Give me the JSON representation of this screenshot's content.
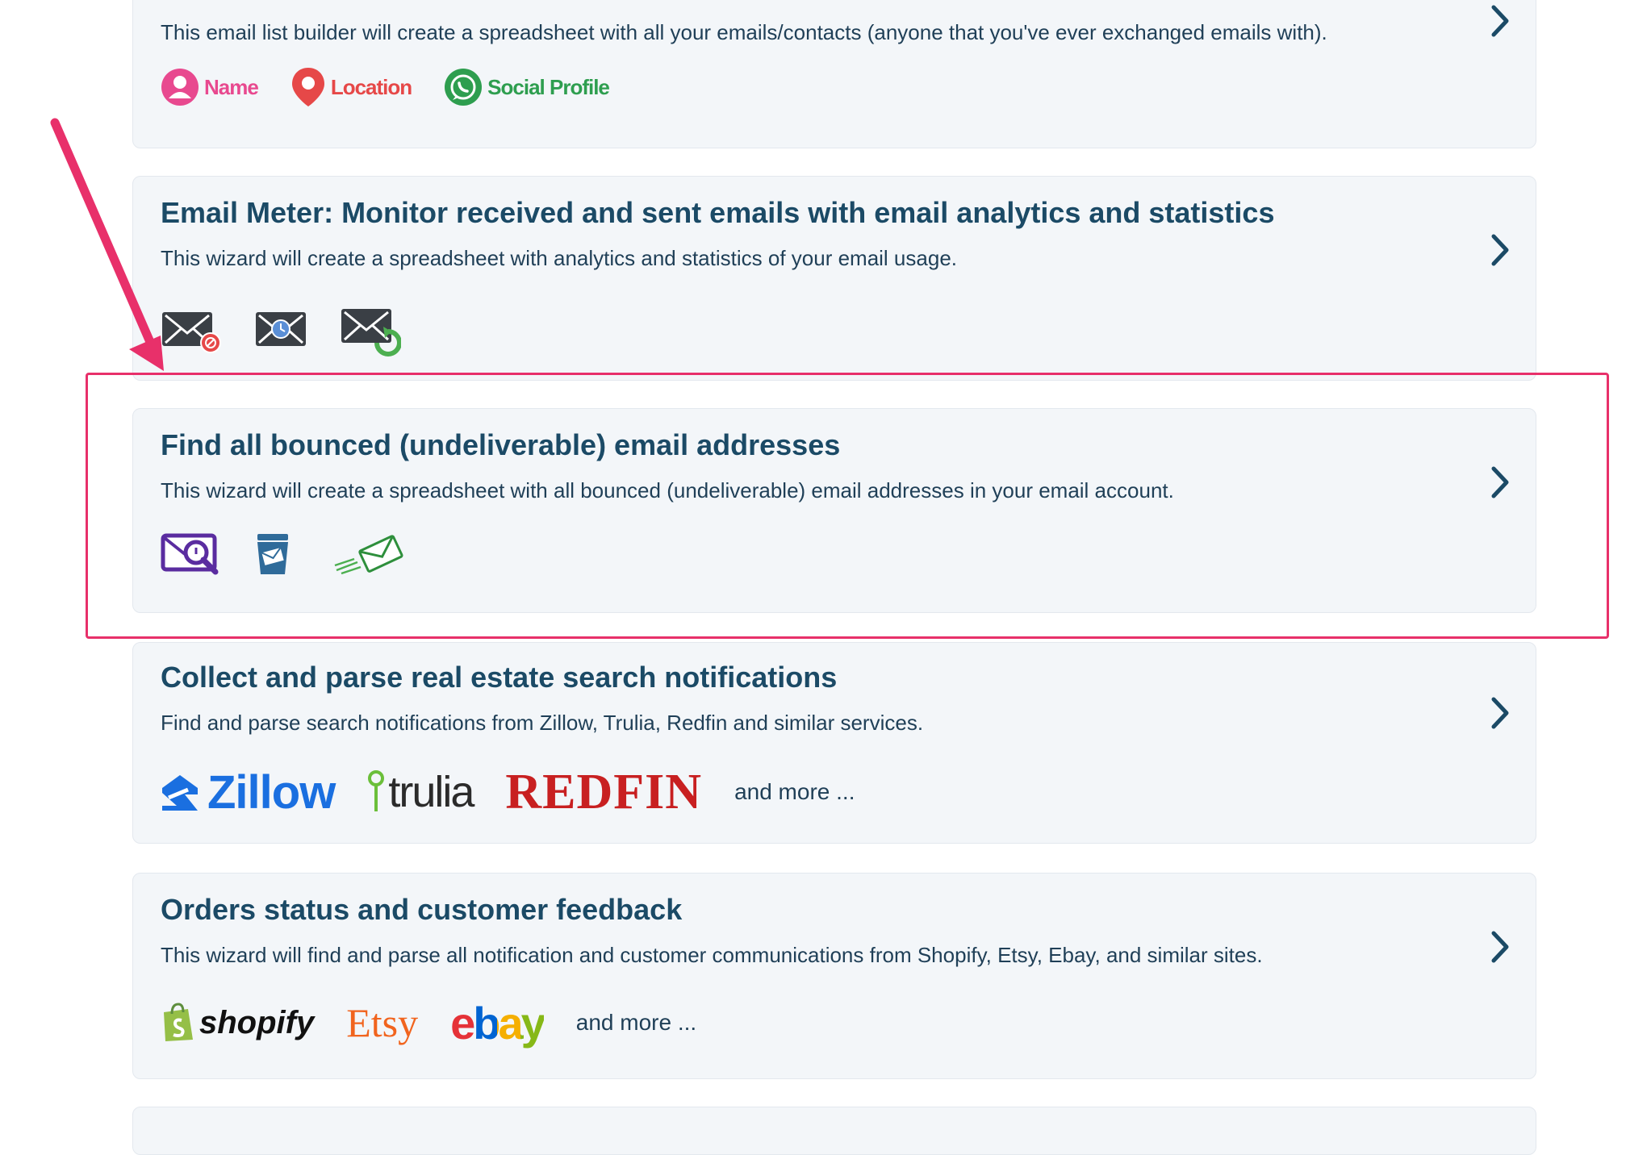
{
  "cards": [
    {
      "description": "This email list builder will create a spreadsheet with all your emails/contacts (anyone that you've ever exchanged emails with).",
      "tags": [
        {
          "label": "Name",
          "color": "#e8498f",
          "icon": "person-icon"
        },
        {
          "label": "Location",
          "color": "#e64848",
          "icon": "location-pin-icon"
        },
        {
          "label": "Social Profile",
          "color": "#2e9e4f",
          "icon": "whatsapp-icon"
        }
      ]
    },
    {
      "title": "Email Meter: Monitor received and sent emails with email analytics and statistics",
      "description": "This wizard will create a spreadsheet with analytics and statistics of your email usage.",
      "icons": [
        "email-blocked-icon",
        "email-clock-icon",
        "email-refresh-icon"
      ]
    },
    {
      "title": "Find all bounced (undeliverable) email addresses",
      "description": "This wizard will create a spreadsheet with all bounced (undeliverable) email addresses in your email account.",
      "icons": [
        "email-search-icon",
        "email-trash-icon",
        "email-flying-icon"
      ]
    },
    {
      "title": "Collect and parse real estate search notifications",
      "description": "Find and parse search notifications from Zillow, Trulia, Redfin and similar services.",
      "logos": [
        "Zillow",
        "trulia",
        "REDFIN"
      ],
      "more": "and more ..."
    },
    {
      "title": "Orders status and customer feedback",
      "description": "This wizard will find and parse all notification and customer communications from Shopify, Etsy, Ebay, and similar sites.",
      "logos": [
        "shopify",
        "Etsy",
        "ebay"
      ],
      "more": "and more ..."
    }
  ],
  "colors": {
    "annotation": "#e8306a",
    "title": "#1b4a66",
    "card_bg": "#f3f6f9",
    "zillow": "#1a6fe0",
    "redfin": "#c82021",
    "etsy": "#f1641e",
    "shopify_green": "#95bf47"
  }
}
